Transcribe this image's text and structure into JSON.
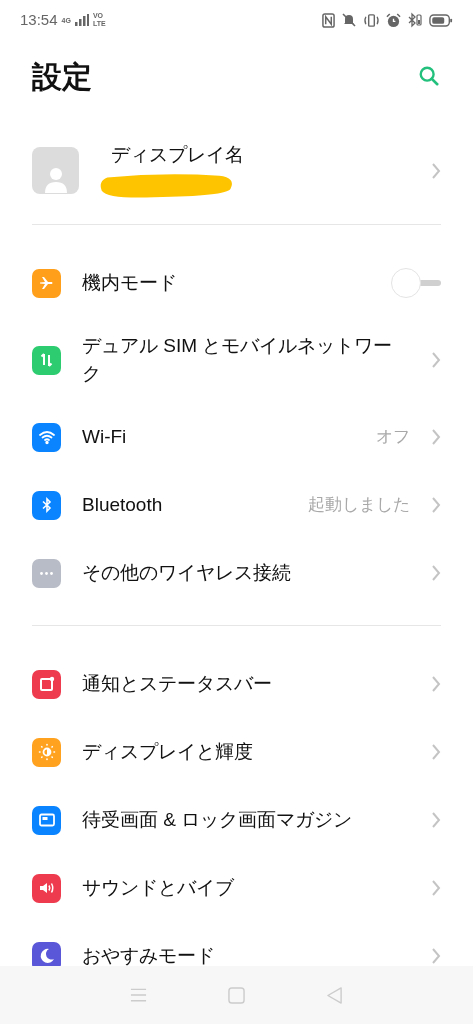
{
  "status_bar": {
    "time": "13:54",
    "network": "4G",
    "volte_top": "VO",
    "volte_bottom": "LTE"
  },
  "header": {
    "title": "設定"
  },
  "profile": {
    "name": "ディスプレイ名"
  },
  "sections": [
    {
      "items": [
        {
          "kind": "toggle",
          "label": "機内モード",
          "color": "#ff9f1a",
          "on": false
        },
        {
          "kind": "link",
          "label": "デュアル SIM とモバイルネットワーク",
          "color": "#2ecc71"
        },
        {
          "kind": "link",
          "label": "Wi-Fi",
          "color": "#0a84ff",
          "value": "オフ"
        },
        {
          "kind": "link",
          "label": "Bluetooth",
          "color": "#0a84ff",
          "value": "起動しました"
        },
        {
          "kind": "link",
          "label": "その他のワイヤレス接続",
          "color": "#b8bcc6"
        }
      ]
    },
    {
      "items": [
        {
          "kind": "link",
          "label": "通知とステータスバー",
          "color": "#ee3c4e"
        },
        {
          "kind": "link",
          "label": "ディスプレイと輝度",
          "color": "#ffa21f"
        },
        {
          "kind": "link",
          "label": "待受画面 & ロック画面マガジン",
          "color": "#0a84ff"
        },
        {
          "kind": "link",
          "label": "サウンドとバイブ",
          "color": "#ee3c4e"
        },
        {
          "kind": "link",
          "label": "おやすみモード",
          "color": "#5b57d9"
        }
      ]
    }
  ]
}
